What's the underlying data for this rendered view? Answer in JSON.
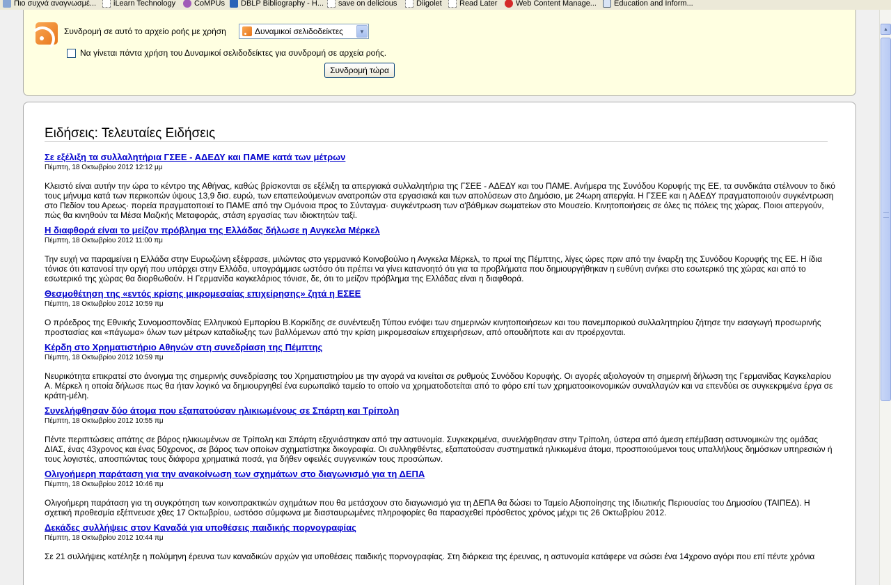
{
  "bookmarks": [
    {
      "label": "Πιο συχνά αναγνωσμέ..."
    },
    {
      "label": "iLearn Technology"
    },
    {
      "label": "CoMPUs"
    },
    {
      "label": "DBLP Bibliography - H..."
    },
    {
      "label": "save on delicious"
    },
    {
      "label": "Diigolet"
    },
    {
      "label": "Read Later"
    },
    {
      "label": "Web Content Manage..."
    },
    {
      "label": "Education and Inform..."
    }
  ],
  "subscribe": {
    "label": "Συνδρομή σε αυτό το αρχείο ροής με χρήση",
    "selected_reader": "Δυναμικοί σελιδοδείκτες",
    "always_use_label": "Να γίνεται πάντα χρήση του Δυναμικοί σελιδοδείκτες για συνδρομή σε αρχεία ροής.",
    "button_label": "Συνδρομή τώρα"
  },
  "feed": {
    "title": "Ειδήσεις: Τελευταίες Ειδήσεις",
    "entries": [
      {
        "title": "Σε εξέλιξη τα συλλαλητήρια ΓΣΕΕ - ΑΔΕΔΥ και ΠΑΜΕ κατά των μέτρων",
        "date": "Πέμπτη, 18 Οκτωβρίου 2012 12:12 μμ",
        "body": "Κλειστό είναι αυτήν την ώρα το κέντρο της Αθήνας, καθώς βρίσκονται σε εξέλιξη τα απεργιακά συλλαλητήρια της ΓΣΕΕ - ΑΔΕΔΥ και του ΠΑΜΕ. Ανήμερα της Συνόδου Κορυφής της ΕΕ, τα συνδικάτα στέλνουν το δικό τους μήνυμα κατά των περικοπών ύψους 13,9 δισ. ευρώ, των επαπειλούμενων ανατροπών στα εργασιακά και των απολύσεων στο Δημόσιο, με 24ωρη απεργία. Η ΓΣΕΕ και η ΑΔΕΔΥ πραγματοποιούν συγκέντρωση στο Πεδίον του Αρεως· πορεία πραγματοποιεί το ΠΑΜΕ από την Ομόνοια προς το Σύνταγμα· συγκέντρωση των α'βάθμιων σωματείων στο Μουσείο. Κινητοποιήσεις σε όλες τις πόλεις της χώρας. Ποιοι απεργούν, πώς θα κινηθούν τα Μέσα Μαζικής Μεταφοράς, στάση εργασίας των ιδιοκτητών ταξί."
      },
      {
        "title": "Η διαφθορά είναι το μείζον πρόβλημα της Ελλάδας δήλωσε η Ανγκελα Μέρκελ",
        "date": "Πέμπτη, 18 Οκτωβρίου 2012 11:00 πμ",
        "body": "Την ευχή να παραμείνει η Ελλάδα στην Ευρωζώνη εξέφρασε, μιλώντας στο γερμανικό Κοινοβούλιο η Ανγκελα Μέρκελ, το πρωί της Πέμπτης, λίγες ώρες πριν από την έναρξη της Συνόδου Κορυφής της ΕΕ. Η ίδια τόνισε ότι κατανοεί την οργή που υπάρχει στην Ελλάδα, υπογράμμισε ωστόσο ότι πρέπει να γίνει κατανοητό ότι για τα προβλήματα που δημιουργήθηκαν η ευθύνη ανήκει στο εσωτερικό της χώρας και από το εσωτερικό της χώρας θα διορθωθούν. Η Γερμανίδα καγκελάριος τόνισε, δε, ότι το μείζον πρόβλημα της Ελλάδας είναι η διαφθορά."
      },
      {
        "title": "Θεσμοθέτηση της «εντός κρίσης μικρομεσαίας επιχείρησης» ζητά η ΕΣΕΕ",
        "date": "Πέμπτη, 18 Οκτωβρίου 2012 10:59 πμ",
        "body": "Ο πρόεδρος της Εθνικής Συνομοσπονδίας Ελληνικού Εμπορίου Β.Κορκίδης σε συνέντευξη Τύπου ενόψει των σημερινών κινητοποιήσεων και του πανεμπορικού συλλαλητηρίου ζήτησε την εισαγωγή προσωρινής προστασίας και «πάγωμα» όλων των μέτρων καταδίωξης των βαλλόμενων από την κρίση μικρομεσαίων επιχειρήσεων, από οπουδήποτε και αν προέρχονται."
      },
      {
        "title": "Κέρδη στο Χρηματιστήριο Αθηνών στη συνεδρίαση της Πέμπτης",
        "date": "Πέμπτη, 18 Οκτωβρίου 2012 10:59 πμ",
        "body": "Νευρικότητα επικρατεί στο άνοιγμα της σημερινής συνεδρίασης του Χρηματιστηρίου με την αγορά να κινείται σε ρυθμούς Συνόδου Κορυφής. Οι αγορές αξιολογούν τη σημερινή δήλωση της Γερμανίδας Καγκελαρίου Α. Μέρκελ η οποία δήλωσε πως θα ήταν λογικό να δημιουργηθεί ένα ευρωπαϊκό ταμείο το οποίο να χρηματοδοτείται από το φόρο επί των χρηματοοικονομικών συναλλαγών και να επενδύει σε συγκεκριμένα έργα σε κράτη-μέλη."
      },
      {
        "title": "Συνελήφθησαν δύο άτομα που εξαπατούσαν ηλικιωμένους σε Σπάρτη και Τρίπολη",
        "date": "Πέμπτη, 18 Οκτωβρίου 2012 10:55 πμ",
        "body": "Πέντε περιπτώσεις απάτης σε βάρος ηλικιωμένων σε Τρίπολη και Σπάρτη εξιχνιάστηκαν από την αστυνομία. Συγκεκριμένα, συνελήφθησαν στην Τρίπολη, ύστερα από άμεση επέμβαση αστυνομικών της ομάδας ΔΙΑΣ, ένας 43χρονος και ένας 50χρονος, σε βάρος των οποίων σχηματίστηκε δικογραφία. Οι συλληφθέντες, εξαπατούσαν συστηματικά ηλικιωμένα άτομα, προσποιούμενοι τους υπαλλήλους δημόσιων υπηρεσιών ή τους λογιστές, αποσπώντας τους διάφορα χρηματικά ποσά, για δήθεν οφειλές συγγενικών τους προσώπων."
      },
      {
        "title": "Ολιγοήμερη παράταση για την ανακοίνωση των σχημάτων στο διαγωνισμό για τη ΔΕΠΑ",
        "date": "Πέμπτη, 18 Οκτωβρίου 2012 10:46 πμ",
        "body": "Ολιγοήμερη παράταση για τη συγκρότηση  των κοινοπρακτικών σχημάτων που θα μετάσχουν στο διαγωνισμό για τη ΔΕΠΑ θα δώσει το Ταμείο Αξιοποίησης της Ιδιωτικής Περιουσίας του Δημοσίου (ΤΑΙΠΕΔ). Η σχετική προθεσμία εξέπνευσε χθες 17 Οκτωβρίου, ωστόσο σύμφωνα με διασταυρωμένες πληροφορίες θα παρασχεθεί πρόσθετος χρόνος μέχρι τις 26 Οκτωβρίου 2012."
      },
      {
        "title": "Δεκάδες συλλήψεις στον Καναδά για υποθέσεις παιδικής πορνογραφίας",
        "date": "Πέμπτη, 18 Οκτωβρίου 2012 10:44 πμ",
        "body": "Σε 21 συλλήψεις κατέληξε η πολύμηνη έρευνα των καναδικών αρχών για υποθέσεις παιδικής πορνογραφίας. Στη διάρκεια της έρευνας, η αστυνομία κατάφερε να σώσει ένα 14χρονο αγόρι που επί πέντε χρόνια"
      }
    ]
  },
  "colors": {
    "link": "#0000cc",
    "subscribe_bg": "#ffffe1",
    "rss_orange": "#e8761a"
  }
}
